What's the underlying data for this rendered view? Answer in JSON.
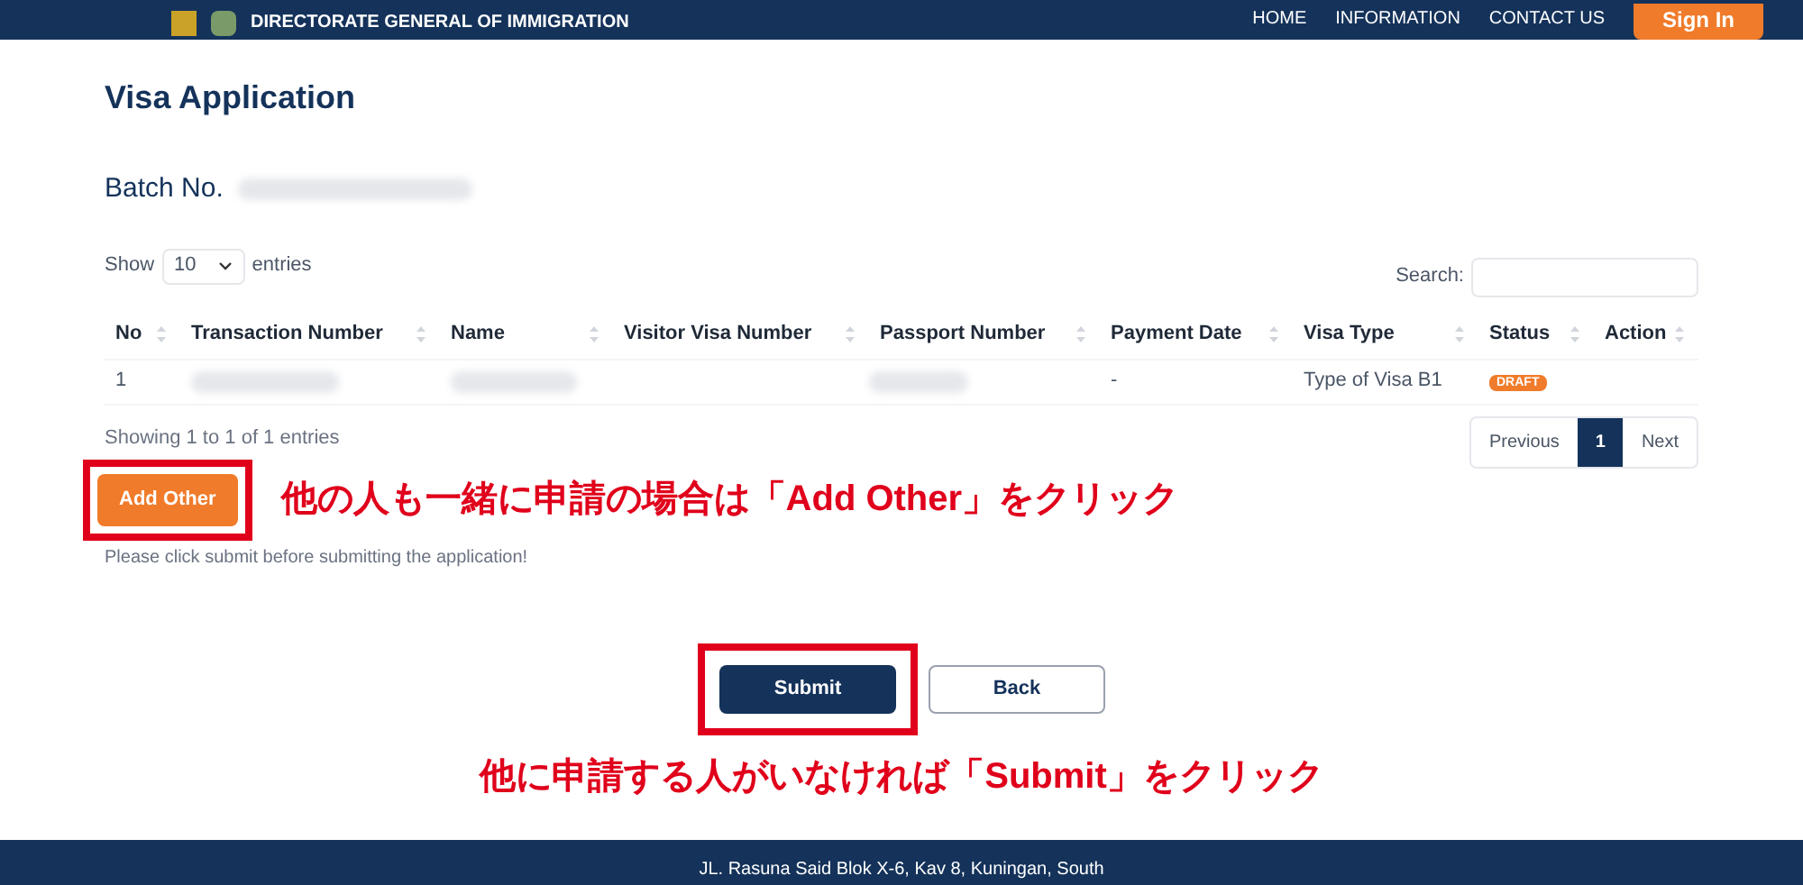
{
  "header": {
    "agency": "DIRECTORATE GENERAL OF IMMIGRATION",
    "nav": [
      "HOME",
      "INFORMATION",
      "CONTACT US"
    ],
    "sign_in": "Sign In"
  },
  "page_title": "Visa Application",
  "batch_label": "Batch No.",
  "length_menu": {
    "before": "Show",
    "value": "10",
    "after": "entries"
  },
  "search": {
    "label": "Search:"
  },
  "table": {
    "columns": [
      "No",
      "Transaction Number",
      "Name",
      "Visitor Visa Number",
      "Passport Number",
      "Payment Date",
      "Visa Type",
      "Status",
      "Action"
    ],
    "rows": [
      {
        "no": "1",
        "payment_date": "-",
        "visa_type": "Type of Visa B1",
        "status": "DRAFT"
      }
    ]
  },
  "info": "Showing 1 to 1 of 1 entries",
  "pagination": [
    {
      "label": "Previous",
      "selected": false
    },
    {
      "label": "1",
      "selected": true
    },
    {
      "label": "Next",
      "selected": false
    }
  ],
  "add_other": "Add Other",
  "add_other_note": "他の人も一緒に申請の場合は「Add Other」をクリック",
  "notice": "Please click submit before submitting the application!",
  "submit": "Submit",
  "back": "Back",
  "submit_note": "他に申請する人がいなければ「Submit」をクリック",
  "footer": {
    "address": "JL. Rasuna Said Blok X-6, Kav 8, Kuningan, South"
  }
}
